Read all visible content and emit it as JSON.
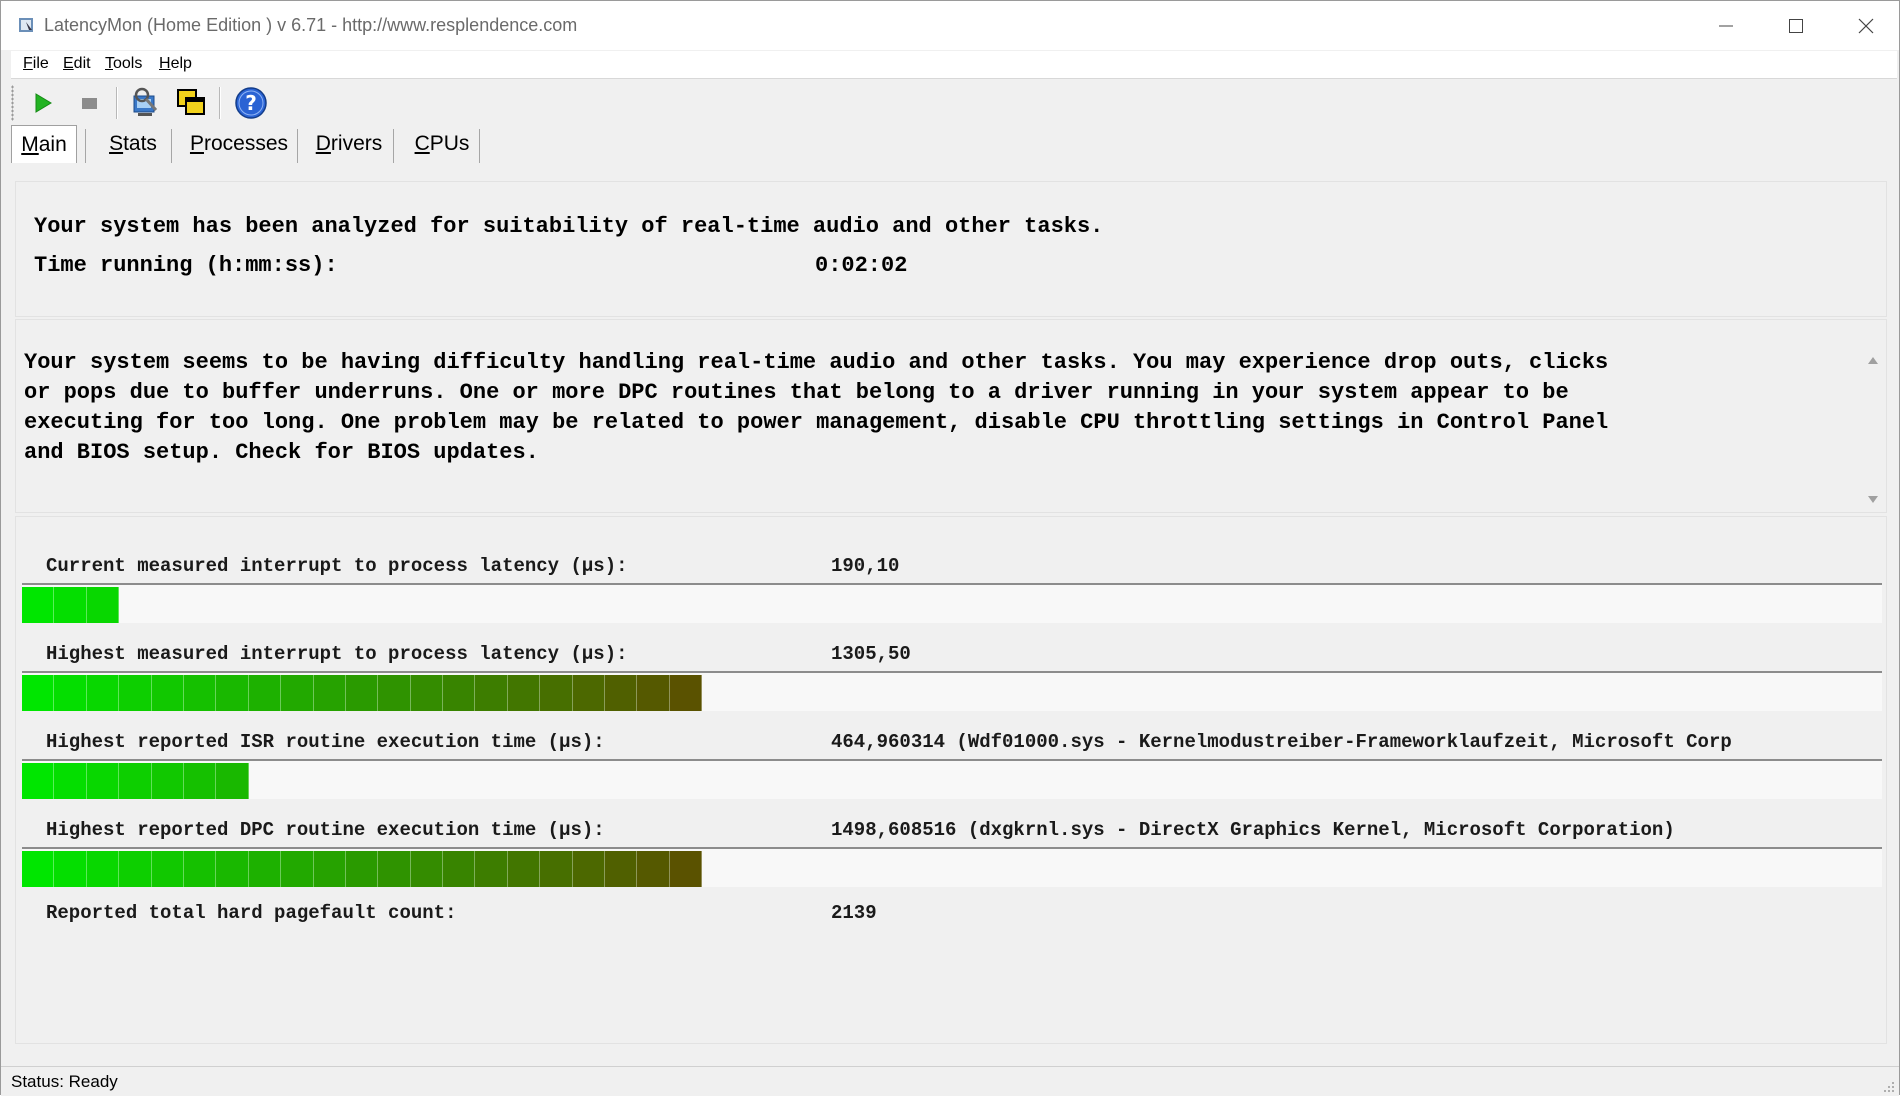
{
  "window": {
    "title": "LatencyMon  (Home Edition )  v 6.71 - http://www.resplendence.com"
  },
  "menu": [
    {
      "label": "File",
      "mnemonic": "F",
      "rest": "ile"
    },
    {
      "label": "Edit",
      "mnemonic": "E",
      "rest": "dit"
    },
    {
      "label": "Tools",
      "mnemonic": "T",
      "rest": "ools"
    },
    {
      "label": "Help",
      "mnemonic": "H",
      "rest": "elp"
    }
  ],
  "toolbar": {
    "buttons": [
      "play-icon",
      "stop-icon",
      "analyze-icon",
      "windows-icon",
      "help-icon"
    ]
  },
  "tabs": [
    {
      "label": "Main",
      "mnemonic": "M",
      "rest": "ain",
      "active": true
    },
    {
      "label": "Stats",
      "mnemonic": "S",
      "rest": "tats",
      "active": false
    },
    {
      "label": "Processes",
      "mnemonic": "P",
      "rest": "rocesses",
      "active": false
    },
    {
      "label": "Drivers",
      "mnemonic": "D",
      "rest": "rivers",
      "active": false
    },
    {
      "label": "CPUs",
      "mnemonic": "C",
      "rest": "PUs",
      "active": false
    }
  ],
  "summary": {
    "line1": "Your system has been analyzed for suitability of real-time audio and other tasks.",
    "time_label": "Time running (h:mm:ss):",
    "time_value": "0:02:02"
  },
  "advice": "Your system seems to be having difficulty handling real-time audio and other tasks. You may experience drop outs, clicks\nor pops due to buffer underruns. One or more DPC routines that belong to a driver running in your system appear to be\nexecuting for too long. One problem may be related to power management, disable CPU throttling settings in Control Panel\nand BIOS setup. Check for BIOS updates.",
  "metrics": [
    {
      "label": "Current measured interrupt to process latency (µs):",
      "value": "190,10",
      "segments": 3
    },
    {
      "label": "Highest measured interrupt to process latency (µs):",
      "value": "1305,50",
      "segments": 21
    },
    {
      "label": "Highest reported ISR routine execution time (µs):",
      "value": "464,960314   (Wdf01000.sys - Kernelmodustreiber-Frameworklaufzeit, Microsoft Corp",
      "segments": 7
    },
    {
      "label": "Highest reported DPC routine execution time (µs):",
      "value": "1498,608516   (dxgkrnl.sys - DirectX Graphics Kernel, Microsoft Corporation)",
      "segments": 21
    }
  ],
  "pagefault": {
    "label": "Reported total hard pagefault count:",
    "value": "2139"
  },
  "status": "Status: Ready",
  "colors": {
    "bar_start": "#00e600",
    "bar_mid": "#2a9a00",
    "bar_end": "#5a5200"
  }
}
